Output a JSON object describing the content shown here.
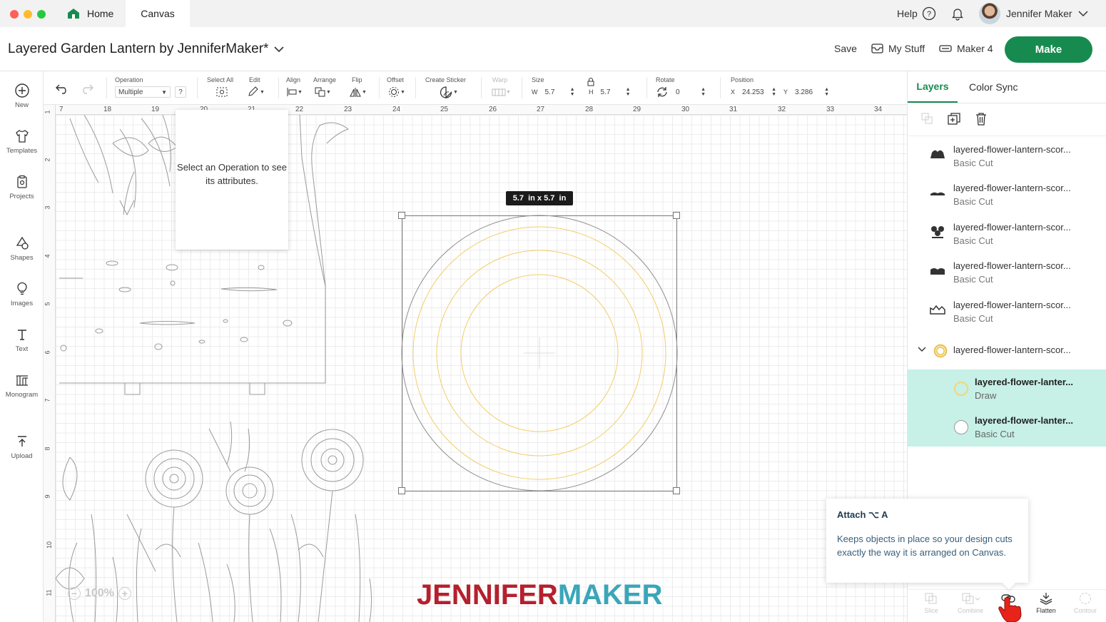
{
  "titlebar": {
    "home": "Home",
    "canvas": "Canvas",
    "help": "Help",
    "user": "Jennifer Maker"
  },
  "project": {
    "title": "Layered Garden Lantern by JenniferMaker*",
    "save": "Save",
    "my_stuff": "My Stuff",
    "machine": "Maker 4",
    "make": "Make"
  },
  "sidebar": {
    "items": [
      {
        "label": "New",
        "icon": "plus-circle-icon"
      },
      {
        "label": "Templates",
        "icon": "shirt-icon"
      },
      {
        "label": "Projects",
        "icon": "clipboard-icon"
      },
      {
        "label": "Shapes",
        "icon": "shapes-icon"
      },
      {
        "label": "Images",
        "icon": "lightbulb-icon"
      },
      {
        "label": "Text",
        "icon": "text-icon"
      },
      {
        "label": "Monogram",
        "icon": "monogram-icon"
      },
      {
        "label": "Upload",
        "icon": "upload-icon"
      }
    ]
  },
  "toolbar": {
    "operation_label": "Operation",
    "operation_value": "Multiple",
    "help": "?",
    "select_all": "Select All",
    "edit": "Edit",
    "align": "Align",
    "arrange": "Arrange",
    "flip": "Flip",
    "offset": "Offset",
    "create_sticker": "Create Sticker",
    "warp": "Warp",
    "size": "Size",
    "w_label": "W",
    "w_value": "5.7",
    "h_label": "H",
    "h_value": "5.7",
    "rotate": "Rotate",
    "rotate_value": "0",
    "position": "Position",
    "x_label": "X",
    "x_value": "24.253",
    "y_label": "Y",
    "y_value": "3.286"
  },
  "ruler": {
    "top": [
      "7",
      "18",
      "19",
      "20",
      "21",
      "22",
      "23",
      "24",
      "25",
      "26",
      "27",
      "28",
      "29",
      "30",
      "31",
      "32",
      "33",
      "34"
    ],
    "left": [
      "1",
      "2",
      "3",
      "4",
      "5",
      "6",
      "7",
      "8",
      "9",
      "10",
      "11"
    ]
  },
  "canvas": {
    "tooltip": "Select an Operation to see its attributes.",
    "size_badge": "5.7  in x 5.7  in",
    "zoom": "100%"
  },
  "watermark": {
    "part1": "JENNIFER",
    "part2": "MAKER",
    "color1": "#b5202e",
    "color2": "#3aa6b9"
  },
  "panel": {
    "tabs": [
      "Layers",
      "Color Sync"
    ],
    "layers": [
      {
        "name": "layered-flower-lantern-scor...",
        "sub": "Basic Cut"
      },
      {
        "name": "layered-flower-lantern-scor...",
        "sub": "Basic Cut"
      },
      {
        "name": "layered-flower-lantern-scor...",
        "sub": "Basic Cut"
      },
      {
        "name": "layered-flower-lantern-scor...",
        "sub": "Basic Cut"
      },
      {
        "name": "layered-flower-lantern-scor...",
        "sub": "Basic Cut"
      }
    ],
    "group": {
      "name": "layered-flower-lantern-scor..."
    },
    "children": [
      {
        "name": "layered-flower-lanter...",
        "sub": "Draw"
      },
      {
        "name": "layered-flower-lanter...",
        "sub": "Basic Cut"
      }
    ]
  },
  "attach_tooltip": {
    "title": "Attach ⌥ A",
    "desc": "Keeps objects in place so your design cuts exactly the way it is arranged on Canvas."
  },
  "bottom_tools": {
    "slice": "Slice",
    "combine": "Combine",
    "attach": "A",
    "flatten": "Flatten",
    "contour": "Contour"
  },
  "colors": {
    "make": "#178b4f",
    "selected_layer": "#c7f0e6",
    "accent": "#178b4f"
  }
}
